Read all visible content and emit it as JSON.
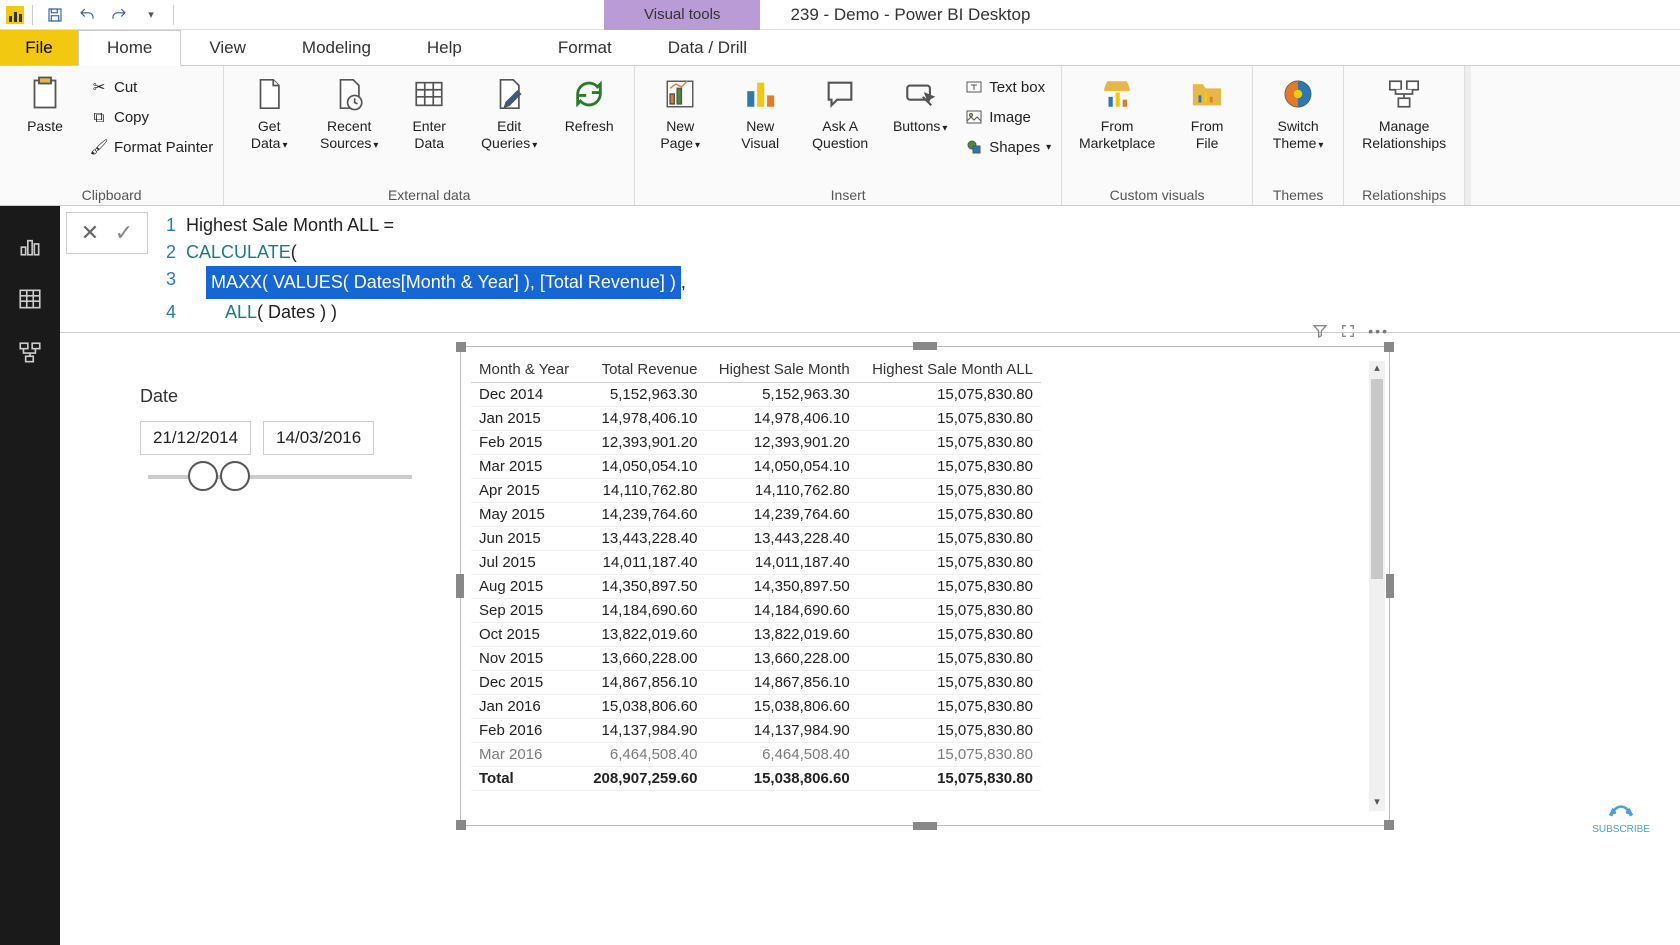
{
  "titlebar": {
    "contextual_label": "Visual tools",
    "document_title": "239 - Demo - Power BI Desktop"
  },
  "tabs": {
    "file": "File",
    "home": "Home",
    "view": "View",
    "modeling": "Modeling",
    "help": "Help",
    "format": "Format",
    "data_drill": "Data / Drill"
  },
  "ribbon": {
    "clipboard": {
      "label": "Clipboard",
      "paste": "Paste",
      "cut": "Cut",
      "copy": "Copy",
      "format_painter": "Format Painter"
    },
    "external": {
      "label": "External data",
      "get_data": "Get\nData",
      "recent_sources": "Recent\nSources",
      "enter_data": "Enter\nData",
      "edit_queries": "Edit\nQueries",
      "refresh": "Refresh"
    },
    "insert": {
      "label": "Insert",
      "new_page": "New\nPage",
      "new_visual": "New\nVisual",
      "ask": "Ask A\nQuestion",
      "buttons": "Buttons",
      "textbox": "Text box",
      "image": "Image",
      "shapes": "Shapes"
    },
    "custom": {
      "label": "Custom visuals",
      "marketplace": "From\nMarketplace",
      "file": "From\nFile"
    },
    "themes": {
      "label": "Themes",
      "switch": "Switch\nTheme"
    },
    "relationships": {
      "label": "Relationships",
      "manage": "Manage\nRelationships"
    }
  },
  "formula": {
    "line1": "Highest Sale Month ALL =",
    "line2_fn": "CALCULATE",
    "line2_rest": "(",
    "line3_pre": "    ",
    "line3_hl_fn1": "MAXX",
    "line3_hl_p1": "( ",
    "line3_hl_fn2": "VALUES",
    "line3_hl_p2": "( ",
    "line3_hl_col": "Dates[Month & Year]",
    "line3_hl_p3": " ), ",
    "line3_hl_meas": "[Total Revenue]",
    "line3_hl_p4": " )",
    "line3_post": ",",
    "line4_pre": "        ",
    "line4_fn": "ALL",
    "line4_rest": "( Dates ) )"
  },
  "slicer": {
    "title": "Date",
    "from": "21/12/2014",
    "to": "14/03/2016"
  },
  "table": {
    "headers": [
      "Month & Year",
      "Total Revenue",
      "Highest Sale Month",
      "Highest Sale Month ALL"
    ],
    "rows": [
      [
        "Dec 2014",
        "5,152,963.30",
        "5,152,963.30",
        "15,075,830.80"
      ],
      [
        "Jan 2015",
        "14,978,406.10",
        "14,978,406.10",
        "15,075,830.80"
      ],
      [
        "Feb 2015",
        "12,393,901.20",
        "12,393,901.20",
        "15,075,830.80"
      ],
      [
        "Mar 2015",
        "14,050,054.10",
        "14,050,054.10",
        "15,075,830.80"
      ],
      [
        "Apr 2015",
        "14,110,762.80",
        "14,110,762.80",
        "15,075,830.80"
      ],
      [
        "May 2015",
        "14,239,764.60",
        "14,239,764.60",
        "15,075,830.80"
      ],
      [
        "Jun 2015",
        "13,443,228.40",
        "13,443,228.40",
        "15,075,830.80"
      ],
      [
        "Jul 2015",
        "14,011,187.40",
        "14,011,187.40",
        "15,075,830.80"
      ],
      [
        "Aug 2015",
        "14,350,897.50",
        "14,350,897.50",
        "15,075,830.80"
      ],
      [
        "Sep 2015",
        "14,184,690.60",
        "14,184,690.60",
        "15,075,830.80"
      ],
      [
        "Oct 2015",
        "13,822,019.60",
        "13,822,019.60",
        "15,075,830.80"
      ],
      [
        "Nov 2015",
        "13,660,228.00",
        "13,660,228.00",
        "15,075,830.80"
      ],
      [
        "Dec 2015",
        "14,867,856.10",
        "14,867,856.10",
        "15,075,830.80"
      ],
      [
        "Jan 2016",
        "15,038,806.60",
        "15,038,806.60",
        "15,075,830.80"
      ],
      [
        "Feb 2016",
        "14,137,984.90",
        "14,137,984.90",
        "15,075,830.80"
      ],
      [
        "Mar 2016",
        "6,464,508.40",
        "6,464,508.40",
        "15,075,830.80"
      ]
    ],
    "total_label": "Total",
    "totals": [
      "208,907,259.60",
      "15,038,806.60",
      "15,075,830.80"
    ]
  },
  "subscribe": "SUBSCRIBE"
}
